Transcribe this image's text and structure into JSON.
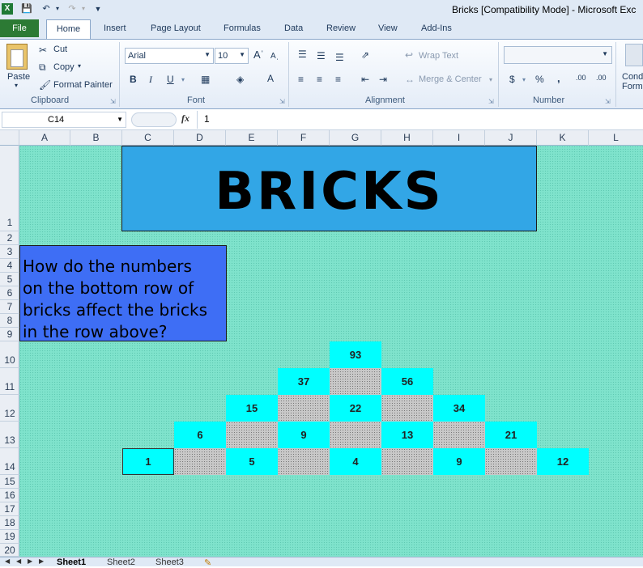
{
  "window": {
    "title": "Bricks  [Compatibility Mode]  -  Microsoft Exc"
  },
  "quick_access": {
    "icons": [
      "excel-icon",
      "save-icon",
      "undo-icon",
      "redo-icon",
      "customize-icon"
    ]
  },
  "tabs": {
    "file": "File",
    "items": [
      "Home",
      "Insert",
      "Page Layout",
      "Formulas",
      "Data",
      "Review",
      "View",
      "Add-Ins"
    ]
  },
  "ribbon": {
    "clipboard": {
      "label": "Clipboard",
      "paste": "Paste",
      "cut": "Cut",
      "copy": "Copy",
      "format_painter": "Format Painter"
    },
    "font": {
      "label": "Font",
      "name": "Arial",
      "size": "10",
      "bold": "B",
      "italic": "I",
      "underline": "U"
    },
    "alignment": {
      "label": "Alignment",
      "wrap_text": "Wrap Text",
      "merge_center": "Merge & Center"
    },
    "number": {
      "label": "Number",
      "format": "",
      "currency": "$",
      "percent": "%",
      "comma": ",",
      "inc_decimal": ".00",
      "dec_decimal": ".00"
    },
    "styles": {
      "conditional_line1": "Cond",
      "conditional_line2": "Form"
    }
  },
  "formula_bar": {
    "name_box": "C14",
    "fx": "fx",
    "value": "1"
  },
  "columns": [
    "A",
    "B",
    "C",
    "D",
    "E",
    "F",
    "G",
    "H",
    "I",
    "J",
    "K",
    "L"
  ],
  "rows": [
    "1",
    "2",
    "3",
    "4",
    "5",
    "6",
    "7",
    "8",
    "9",
    "10",
    "11",
    "12",
    "13",
    "14",
    "15",
    "16",
    "17",
    "18",
    "19",
    "20"
  ],
  "sheet": {
    "banner": "BRICKS",
    "question_lines": [
      "How do the numbers",
      "on the bottom row of",
      "bricks affect the bricks",
      "in the row above?"
    ],
    "bricks": {
      "row10": [
        "93"
      ],
      "row11": [
        "37",
        "56"
      ],
      "row12": [
        "15",
        "22",
        "34"
      ],
      "row13": [
        "6",
        "9",
        "13",
        "21"
      ],
      "row14": [
        "1",
        "5",
        "4",
        "9",
        "12"
      ]
    }
  },
  "sheet_tabs": [
    "Sheet1",
    "Sheet2",
    "Sheet3"
  ],
  "colors": {
    "background": "#7fe3cc",
    "brick": "#00ffff",
    "banner": "#32a6e6",
    "question_box": "#3e6ef5",
    "file_tab": "#2c7a34"
  }
}
